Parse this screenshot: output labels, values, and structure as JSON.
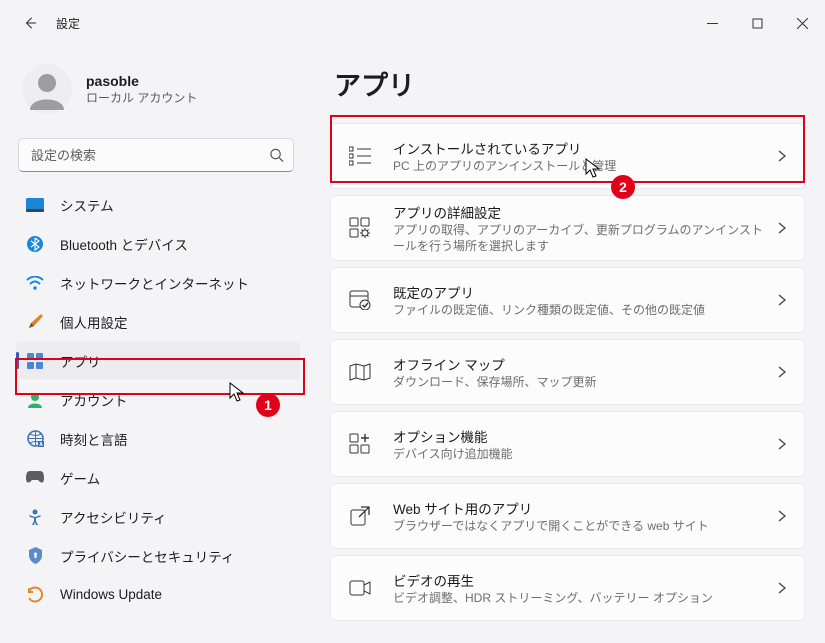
{
  "window": {
    "title": "設定"
  },
  "user": {
    "name": "pasoble",
    "subtitle": "ローカル アカウント"
  },
  "search": {
    "placeholder": "設定の検索"
  },
  "sidebar": {
    "items": [
      {
        "label": "システム"
      },
      {
        "label": "Bluetooth とデバイス"
      },
      {
        "label": "ネットワークとインターネット"
      },
      {
        "label": "個人用設定"
      },
      {
        "label": "アプリ"
      },
      {
        "label": "アカウント"
      },
      {
        "label": "時刻と言語"
      },
      {
        "label": "ゲーム"
      },
      {
        "label": "アクセシビリティ"
      },
      {
        "label": "プライバシーとセキュリティ"
      },
      {
        "label": "Windows Update"
      }
    ]
  },
  "main": {
    "heading": "アプリ",
    "cards": [
      {
        "title": "インストールされているアプリ",
        "subtitle": "PC 上のアプリのアンインストールと管理"
      },
      {
        "title": "アプリの詳細設定",
        "subtitle": "アプリの取得、アプリのアーカイブ、更新プログラムのアンインストールを行う場所を選択します"
      },
      {
        "title": "既定のアプリ",
        "subtitle": "ファイルの既定値、リンク種類の既定値、その他の既定値"
      },
      {
        "title": "オフライン マップ",
        "subtitle": "ダウンロード、保存場所、マップ更新"
      },
      {
        "title": "オプション機能",
        "subtitle": "デバイス向け追加機能"
      },
      {
        "title": "Web サイト用のアプリ",
        "subtitle": "ブラウザーではなくアプリで開くことができる web サイト"
      },
      {
        "title": "ビデオの再生",
        "subtitle": "ビデオ調整、HDR ストリーミング、バッテリー オプション"
      }
    ]
  },
  "annotations": {
    "badge1": "1",
    "badge2": "2"
  }
}
